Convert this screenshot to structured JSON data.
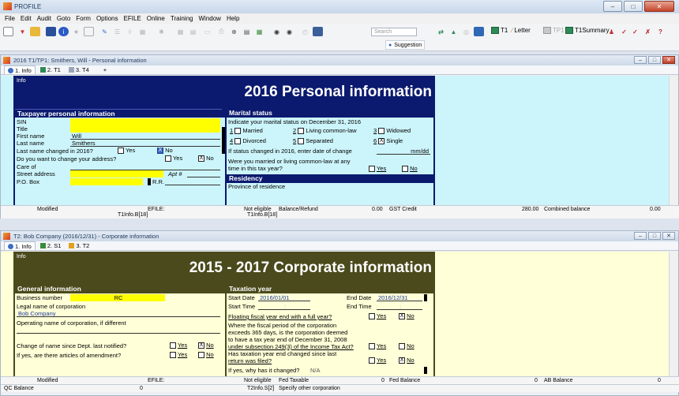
{
  "app": {
    "title": "PROFILE",
    "menu": [
      "File",
      "Edit",
      "Audit",
      "Goto",
      "Form",
      "Options",
      "EFILE",
      "Online",
      "Training",
      "Window",
      "Help"
    ],
    "search_placeholder": "Search",
    "toolbar_labels": {
      "t1": "T1",
      "letter": "Letter",
      "tp1": "TP1",
      "t1summary": "T1Summary"
    },
    "suggestion": "Suggestion"
  },
  "doc1": {
    "title": "2016 T1/TP1: Smithers, Will - Personal information",
    "tabs": [
      "1. Info",
      "2. T1",
      "3. T4",
      "+"
    ],
    "info_label": "Info",
    "heading": "2016 Personal information",
    "taxpayer": {
      "header": "Taxpayer personal information",
      "sin_label": "SIN",
      "title_label": "Title",
      "first_name_label": "First name",
      "first_name": "Will",
      "last_name_label": "Last name",
      "last_name": "Smithers",
      "name_changed_label": "Last name changed in 2016?",
      "yes": "Yes",
      "no": "No",
      "change_address_label": "Do you want to change your address?",
      "care_of_label": "Care of",
      "street_label": "Street address",
      "apt_label": "Apt #",
      "pobox_label": "P.O. Box",
      "rr_label": "R.R."
    },
    "marital": {
      "header": "Marital status",
      "question": "Indicate your marital status on December 31, 2016",
      "options": [
        {
          "num": "1",
          "label": "Married"
        },
        {
          "num": "2",
          "label": "Living common-law"
        },
        {
          "num": "3",
          "label": "Widowed"
        },
        {
          "num": "4",
          "label": "Divorced"
        },
        {
          "num": "5",
          "label": "Separated"
        },
        {
          "num": "6",
          "label": "Single"
        }
      ],
      "status_changed_label": "If status changed in 2016, enter date of change",
      "date_hint": "mm/dd",
      "married_q1": "Were you married or living common-law at any",
      "married_q2": "time in this tax year?",
      "yes": "Yes",
      "no": "No"
    },
    "residency": {
      "header": "Residency",
      "province_label": "Province of residence"
    },
    "status": {
      "modified": "Modified",
      "efile": "EFILE:",
      "not_eligible": "Not eligible",
      "balance_label": "Balance/Refund",
      "balance_value": "0.00",
      "gst_label": "GST Credit",
      "gst_value": "280.00",
      "combined_label": "Combined balance",
      "combined_value": "0.00",
      "ref1": "T1Info.B[18]",
      "ref2": "T1Info.B[18]"
    }
  },
  "doc2": {
    "title": "T2: Bob Company (2016/12/31) - Corporate information",
    "tabs": [
      "1. Info",
      "2. S1",
      "3. T2"
    ],
    "info_label": "Info",
    "heading": "2015 - 2017 Corporate information",
    "general": {
      "header": "General information",
      "business_number_label": "Business number",
      "business_number": "RC",
      "legal_name_label": "Legal name of corporation",
      "legal_name": "Bob Company",
      "operating_name_label": "Operating name of corporation, if different",
      "name_change_label": "Change of name since Dept. last notified?",
      "articles_label": "If yes, are there articles of amendment?",
      "yes": "Yes",
      "no": "No"
    },
    "taxation": {
      "header": "Taxation year",
      "start_date_label": "Start Date",
      "start_date": "2016/01/01",
      "end_date_label": "End Date",
      "end_date": "2016/12/31",
      "start_time_label": "Start Time",
      "start_time": ":",
      "end_time_label": "End Time",
      "end_time": ":",
      "floating_label": "Floating fiscal year end with a full year?",
      "fiscal_q1": "Where the fiscal period of the corporation",
      "fiscal_q2": "exceeds 365 days, is the corporation deemed",
      "fiscal_q3": "to have a tax year end of December 31, 2008",
      "fiscal_q4": "under subsection 249(3) of the Income Tax Act?",
      "changed_q1": "Has taxation year end changed since last",
      "changed_q2": "return was filed?",
      "why_changed": "If yes, why has it changed?",
      "why_value": "N/A",
      "yes": "Yes",
      "no": "No"
    },
    "status": {
      "modified": "Modified",
      "efile": "EFILE:",
      "not_eligible": "Not eligible",
      "fed_taxable_label": "Fed Taxable",
      "fed_taxable_value": "0",
      "fed_balance_label": "Fed Balance",
      "fed_balance_value": "0",
      "ab_balance_label": "AB Balance",
      "ab_balance_value": "0",
      "qc_balance_label": "QC Balance",
      "qc_balance_value": "0",
      "ref": "T2Info.S[2]",
      "ref_desc": "Specify other corporation"
    }
  },
  "colors": {
    "doc1_header": "#0b1a6e",
    "doc1_bg": "#ccf5fb",
    "doc2_header": "#4a4a1c",
    "doc2_bg": "#ffffd8",
    "field_yellow": "#ffff00"
  }
}
